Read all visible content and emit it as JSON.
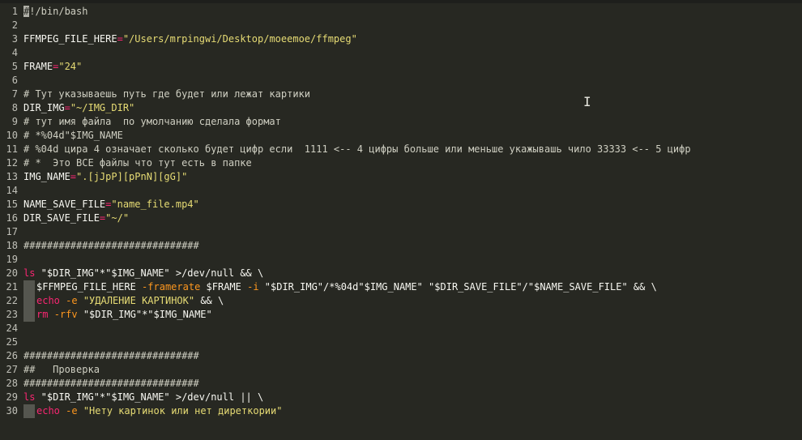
{
  "editor": {
    "language": "bash",
    "lines": [
      {
        "n": "1",
        "tokens": [
          [
            "cursor",
            "#"
          ],
          [
            "cmt",
            "!/bin/bash"
          ]
        ]
      },
      {
        "n": "2",
        "tokens": []
      },
      {
        "n": "3",
        "tokens": [
          [
            "var",
            "FFMPEG_FILE_HERE"
          ],
          [
            "op",
            "="
          ],
          [
            "str",
            "\"/Users/mrpingwi/Desktop/moeemoe/ffmpeg\""
          ]
        ]
      },
      {
        "n": "4",
        "tokens": []
      },
      {
        "n": "5",
        "tokens": [
          [
            "var",
            "FRAME"
          ],
          [
            "op",
            "="
          ],
          [
            "str",
            "\"24\""
          ]
        ]
      },
      {
        "n": "6",
        "tokens": []
      },
      {
        "n": "7",
        "tokens": [
          [
            "cmt",
            "# Тут указываешь путь где будет или лежат картики"
          ]
        ]
      },
      {
        "n": "8",
        "tokens": [
          [
            "var",
            "DIR_IMG"
          ],
          [
            "op",
            "="
          ],
          [
            "str",
            "\"~/IMG_DIR\""
          ]
        ]
      },
      {
        "n": "9",
        "tokens": [
          [
            "cmt",
            "# тут имя файла  по умолчанию сделала формат"
          ]
        ]
      },
      {
        "n": "10",
        "tokens": [
          [
            "cmt",
            "# *%04d\"$IMG_NAME"
          ]
        ]
      },
      {
        "n": "11",
        "tokens": [
          [
            "cmt",
            "# %04d цира 4 означает сколько будет цифр если  1111 <-- 4 цифры больше или меньше укажывашь чило 33333 <-- 5 цифр"
          ]
        ]
      },
      {
        "n": "12",
        "tokens": [
          [
            "cmt",
            "# *  Это ВСЕ файлы что тут есть в папке"
          ]
        ]
      },
      {
        "n": "13",
        "tokens": [
          [
            "var",
            "IMG_NAME"
          ],
          [
            "op",
            "="
          ],
          [
            "str",
            "\".[jJpP][pPnN][gG]\""
          ]
        ]
      },
      {
        "n": "14",
        "tokens": []
      },
      {
        "n": "15",
        "tokens": [
          [
            "var",
            "NAME_SAVE_FILE"
          ],
          [
            "op",
            "="
          ],
          [
            "str",
            "\"name_file.mp4\""
          ]
        ]
      },
      {
        "n": "16",
        "tokens": [
          [
            "var",
            "DIR_SAVE_FILE"
          ],
          [
            "op",
            "="
          ],
          [
            "str",
            "\"~/\""
          ]
        ]
      },
      {
        "n": "17",
        "tokens": []
      },
      {
        "n": "18",
        "tokens": [
          [
            "cmt",
            "##############################"
          ]
        ]
      },
      {
        "n": "19",
        "tokens": []
      },
      {
        "n": "20",
        "tokens": [
          [
            "cmd",
            "ls"
          ],
          [
            "text",
            " \"$DIR_IMG\"*\"$IMG_NAME\" >/dev/null && \\"
          ]
        ]
      },
      {
        "n": "21",
        "tokens": [
          [
            "indent",
            ""
          ],
          [
            "text",
            "$FFMPEG_FILE_HERE "
          ],
          [
            "flag",
            "-framerate"
          ],
          [
            "text",
            " $FRAME "
          ],
          [
            "flag",
            "-i"
          ],
          [
            "text",
            " \"$DIR_IMG\"/*%04d\"$IMG_NAME\" \"$DIR_SAVE_FILE\"/\"$NAME_SAVE_FILE\" && \\"
          ]
        ]
      },
      {
        "n": "22",
        "tokens": [
          [
            "indent",
            ""
          ],
          [
            "cmd",
            "echo"
          ],
          [
            "text",
            " "
          ],
          [
            "flag",
            "-e"
          ],
          [
            "text",
            " "
          ],
          [
            "str",
            "\"УДАЛЕНИЕ КАРТИНОК\""
          ],
          [
            "text",
            " && \\"
          ]
        ]
      },
      {
        "n": "23",
        "tokens": [
          [
            "indent",
            ""
          ],
          [
            "cmd",
            "rm"
          ],
          [
            "text",
            " "
          ],
          [
            "flag",
            "-rfv"
          ],
          [
            "text",
            " \"$DIR_IMG\"*\"$IMG_NAME\""
          ]
        ]
      },
      {
        "n": "24",
        "tokens": []
      },
      {
        "n": "25",
        "tokens": []
      },
      {
        "n": "26",
        "tokens": [
          [
            "cmt",
            "##############################"
          ]
        ]
      },
      {
        "n": "27",
        "tokens": [
          [
            "cmt",
            "##   Проверка"
          ]
        ]
      },
      {
        "n": "28",
        "tokens": [
          [
            "cmt",
            "##############################"
          ]
        ]
      },
      {
        "n": "29",
        "tokens": [
          [
            "cmd",
            "ls"
          ],
          [
            "text",
            " \"$DIR_IMG\"*\"$IMG_NAME\" >/dev/null || \\"
          ]
        ]
      },
      {
        "n": "30",
        "tokens": [
          [
            "indent",
            ""
          ],
          [
            "cmd",
            "echo"
          ],
          [
            "text",
            " "
          ],
          [
            "flag",
            "-e"
          ],
          [
            "text",
            " "
          ],
          [
            "str",
            "\"Нету картинок или нет диреткории\""
          ]
        ]
      }
    ]
  },
  "pointer": {
    "icon": "text-cursor-ibeam-icon",
    "glyph": "I"
  }
}
